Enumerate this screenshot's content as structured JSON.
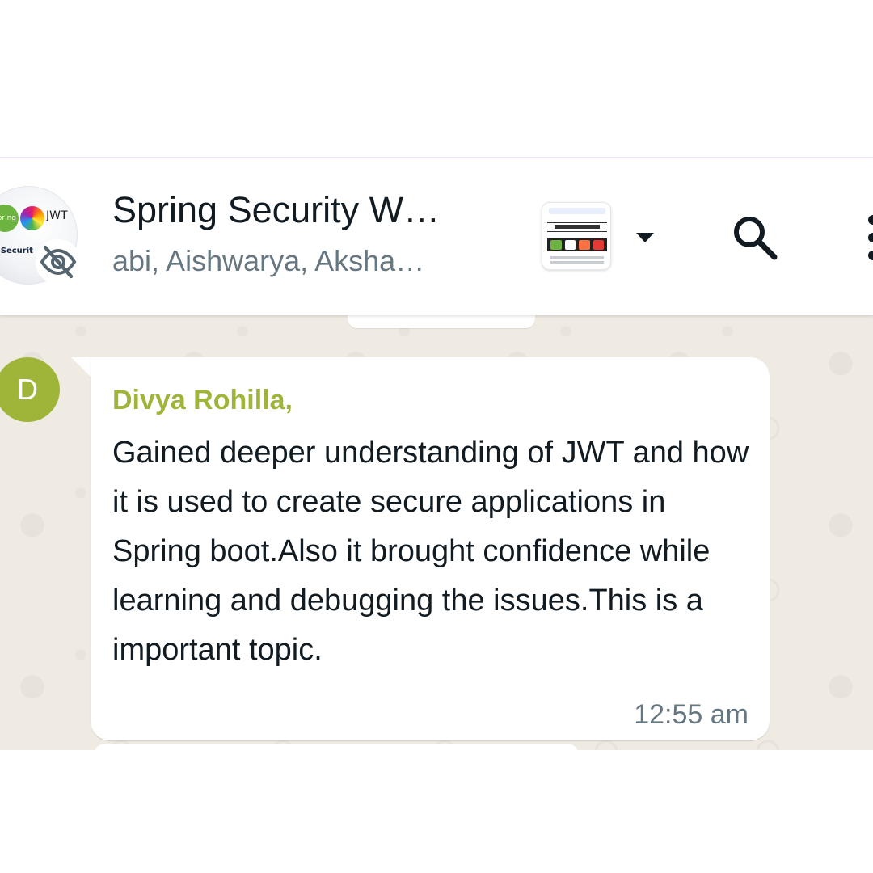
{
  "header": {
    "title": "Spring Security W…",
    "subtitle": "abi, Aishwarya, Aksha…",
    "avatar_logo_text": "ng Securit",
    "avatar_logo_jwt": "JWT",
    "avatar_icon": "eye-off-icon",
    "dropdown_icon": "caret-down-icon",
    "search_icon": "search-icon",
    "menu_icon": "vertical-dots-icon"
  },
  "message": {
    "avatar_letter": "D",
    "sender": "Divya Rohilla,",
    "text": "Gained deeper understanding of JWT and how it is used to create secure applications in Spring boot.Also it brought confidence while learning and debugging the issues.This is a important topic.",
    "time": "12:55 am"
  },
  "colors": {
    "chat_background": "#efeae2",
    "sender_accent": "#9fb53a",
    "bubble": "#ffffff",
    "secondary_text": "#667781",
    "primary_text": "#111b21"
  }
}
